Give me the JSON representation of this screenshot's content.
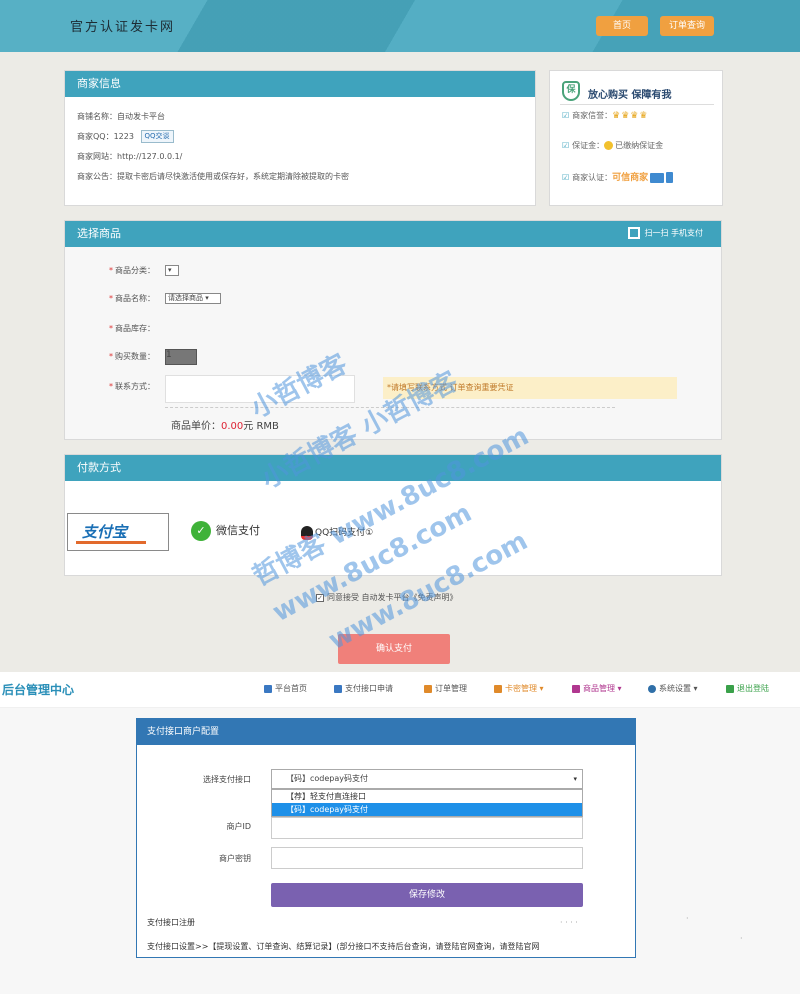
{
  "shop": {
    "site_title": "官方认证发卡网",
    "nav": {
      "home": "首页",
      "order_query": "订单查询"
    },
    "merchant": {
      "title": "商家信息",
      "name_row": "商铺名称：自动发卡平台",
      "qq_row": "商家QQ：1223",
      "qq_badge": "QQ交谈",
      "site_row": "商家网站：http://127.0.0.1/",
      "notice_row": "商家公告：提取卡密后请尽快激活使用或保存好，系统定期清除被提取的卡密"
    },
    "guarantee": {
      "title": "放心购买  保障有我",
      "shield": "保",
      "credit_label": "商家信誉：",
      "crowns": "♛♛♛♛",
      "deposit_label": "保证金：",
      "deposit_value": "已缴纳保证金",
      "cert_label": "商家认证：",
      "cert_value": "可信商家"
    },
    "goods": {
      "title": "选择商品",
      "scan": "扫一扫 手机支付",
      "category_label": "商品分类：",
      "name_label": "商品名称：",
      "name_select": "请选择商品",
      "stock_label": "商品库存：",
      "qty_label": "购买数量：",
      "qty_value": "1",
      "contact_label": "联系方式：",
      "contact_tip": "*请填写联系方式 订单查询重要凭证",
      "price_label": "商品单价：",
      "price_value": "0.00",
      "price_unit": "元 RMB"
    },
    "payment": {
      "title": "付款方式",
      "alipay": "支付宝",
      "wechat": "微信支付",
      "qq": "QQ扫码支付①"
    },
    "agree": "同意接受 自动发卡平台《免责声明》",
    "confirm": "确认支付"
  },
  "watermark": {
    "line1": "小哲博客",
    "line2": "小哲博客 小哲博客",
    "line3": "哲博客 www.8uc8.com",
    "line4": "www.8uc8.com",
    "line5": "www.8uc8.com"
  },
  "admin": {
    "title": "后台管理中心",
    "nav": [
      {
        "label": "平台首页",
        "color": "#3a78c2"
      },
      {
        "label": "支付接口申请",
        "color": "#3a78c2"
      },
      {
        "label": "订单管理",
        "color": "#e08a2a"
      },
      {
        "label": "卡密管理 ▾",
        "color": "#e08a2a"
      },
      {
        "label": "商品管理 ▾",
        "color": "#b0378f"
      },
      {
        "label": "系统设置 ▾",
        "color": "#2f6fa8"
      },
      {
        "label": "退出登陆",
        "color": "#3aa14a"
      }
    ],
    "config": {
      "title": "支付接口商户配置",
      "select_label": "选择支付接口",
      "selected": "【码】codepay码支付",
      "options": [
        "【荐】轻支付直连接口",
        "【码】codepay码支付"
      ],
      "merchant_id_label": "商户ID",
      "merchant_key_label": "商户密钥",
      "save": "保存修改",
      "register": "支付接口注册",
      "settings": "支付接口设置>>【提现设置、订单查询、结算记录】(部分接口不支持后台查询，请登陆官网查询，请登陆官网"
    }
  }
}
